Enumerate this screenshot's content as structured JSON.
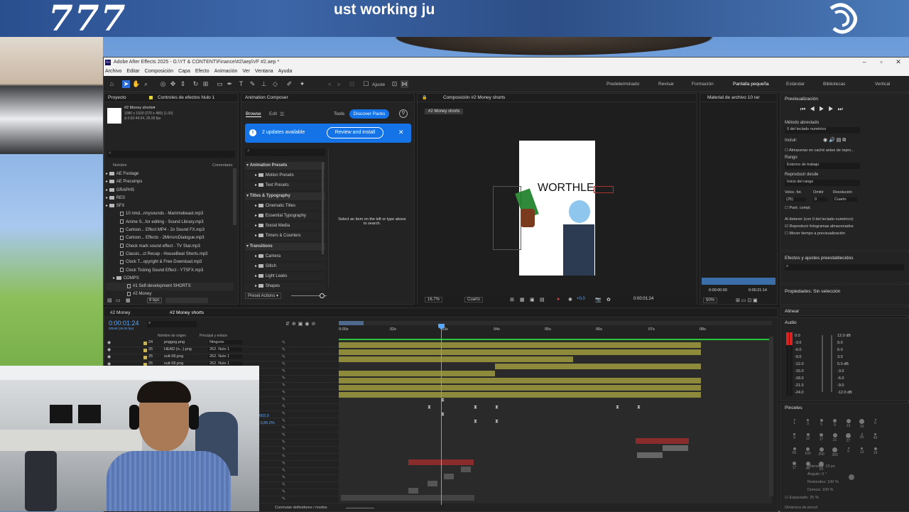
{
  "overlay": {
    "banner_number": "777",
    "banner_subtitle": "ust working ju"
  },
  "app": {
    "title": "Adobe After Effects 2025 - G:\\YT & CONTENT\\Finance\\#2\\aep\\VF #2.aep *",
    "logo": "Ae"
  },
  "menu": [
    "Archivo",
    "Editar",
    "Composición",
    "Capa",
    "Efecto",
    "Animación",
    "Ver",
    "Ventana",
    "Ayuda"
  ],
  "toolbar": {
    "ajuste": "Ajuste",
    "workspaces": [
      "Predeterminado",
      "Revisar",
      "Formación",
      "Pantalla pequeña",
      "Estándar",
      "Bibliotecas",
      "Vertical"
    ]
  },
  "project": {
    "tab_project": "Proyecto",
    "tab_effects": "Controles de efectos Nulo 1",
    "comp_name": "#2 Money shorts▾",
    "comp_info1": "1080 x 1920 (270 x 480) (1.00)",
    "comp_info2": "Δ 0:02:44:24, 25.00 fps",
    "col_name": "Nombre",
    "col_comment": "Comentario",
    "items": [
      {
        "label": "AE Footage",
        "type": "folder",
        "indent": 0
      },
      {
        "label": "AE Precomps",
        "type": "folder",
        "indent": 0
      },
      {
        "label": "GRAPHS",
        "type": "folder",
        "indent": 0
      },
      {
        "label": "RES",
        "type": "folder",
        "indent": 0
      },
      {
        "label": "SFX",
        "type": "folder",
        "indent": 0
      },
      {
        "label": "10 nmd...nnysounds - Mammobeast.mp3",
        "type": "file",
        "indent": 1
      },
      {
        "label": "Anime S...for editing - Sound Library.mp3",
        "type": "file",
        "indent": 1
      },
      {
        "label": "Cartoon... Effect MP4 - 2o Sound FX.mp3",
        "type": "file",
        "indent": 1
      },
      {
        "label": "Cartoon... Effects - 2MirrorsDialogue.mp3",
        "type": "file",
        "indent": 1
      },
      {
        "label": "Check mark sound effect - TV Star.mp3",
        "type": "file",
        "indent": 1
      },
      {
        "label": "Classic...ct Recap - HouseBeat Shorts.mp3",
        "type": "file",
        "indent": 1
      },
      {
        "label": "Clock T...opyright & Free Download.mp3",
        "type": "file",
        "indent": 1
      },
      {
        "label": "Clock Ticking Sound Effect - YTSFX.mp3",
        "type": "file",
        "indent": 1
      },
      {
        "label": "COMPS",
        "type": "folder",
        "indent": 1
      },
      {
        "label": "#1 Self-development SHORTS",
        "type": "comp",
        "indent": 2
      },
      {
        "label": "#2 Money",
        "type": "comp",
        "indent": 2
      }
    ],
    "bpc": "8 bpc"
  },
  "composer": {
    "title": "Animation Composer",
    "tab_browse": "Browse",
    "tab_edit": "Edit",
    "tools": "Tools",
    "discover": "Discover Packs",
    "updates": "2 updates available",
    "review": "Review and install",
    "tree": [
      {
        "label": "Animation Presets",
        "level": 0
      },
      {
        "label": "Motion Presets",
        "level": 1
      },
      {
        "label": "Text Presets",
        "level": 1
      },
      {
        "label": "Titles & Typography",
        "level": 0
      },
      {
        "label": "Cinematic Titles",
        "level": 1
      },
      {
        "label": "Essential Typography",
        "level": 1
      },
      {
        "label": "Social Media",
        "level": 1
      },
      {
        "label": "Timers & Counters",
        "level": 1
      },
      {
        "label": "Transitions",
        "level": 0
      },
      {
        "label": "Camera",
        "level": 1
      },
      {
        "label": "Glitch",
        "level": 1
      },
      {
        "label": "Light Leaks",
        "level": 1
      },
      {
        "label": "Shapes",
        "level": 1
      }
    ],
    "hint": "Select an item on the left or type above to search.",
    "preset_actions": "Preset Actions ▾"
  },
  "composition": {
    "tab": "Composición #2 Money shorts",
    "chip": "#2 Money shorts",
    "zoom": "16.7%",
    "quality": "Cuarto",
    "exposure": "+0.0",
    "timecode": "0:00:01:24",
    "canvas_text": "WORTHLE"
  },
  "footage": {
    "title": "Material de archivo 10 rar",
    "in": "0:00:00:00",
    "out": "0:00:21:14",
    "zoom": "50%"
  },
  "preview": {
    "title": "Previsualización",
    "shortcut_label": "Método abreviado",
    "shortcut": "0 del teclado numérico",
    "include": "Incluir:",
    "cache": "Almacenar en caché antes de repro...",
    "range_label": "Rango",
    "range": "Entorno de trabajo",
    "play_from_label": "Reproducir desde",
    "play_from": "Inicio del rango",
    "fps_label": "Veloc. fot.",
    "skip_label": "Omitir",
    "res_label": "Resolución",
    "fps": "(25)",
    "skip": "0",
    "res": "Cuarto",
    "fullscreen": "Pant. compl.",
    "stop_label": "Al detener (con 0 del teclado numérico):",
    "cached_frames": "Reproducir fotogramas almacenados",
    "move_time": "Mover tiempo a previsualización"
  },
  "effects": {
    "title": "Efectos y ajustes preestablecidos"
  },
  "properties": {
    "title": "Propiedades: Sin selección"
  },
  "align": {
    "title": "Alinear"
  },
  "audio": {
    "title": "Audio",
    "left": [
      "0.0",
      "-3.0",
      "-6.0",
      "-9.0",
      "-12.0",
      "-15.0",
      "-18.0",
      "-21.0",
      "-24.0"
    ],
    "right": [
      "12.0 dB",
      "9.0",
      "6.0",
      "3.0",
      "0.0 dB",
      "-3.0",
      "-6.0",
      "-9.0",
      "-12.0 dB"
    ]
  },
  "brushes": {
    "title": "Pinceles",
    "sizes": [
      "1",
      "3",
      "5",
      "9",
      "13",
      "19",
      "5",
      "9",
      "13",
      "17",
      "21",
      "27",
      "35",
      "45",
      "65",
      "100",
      "200",
      "300",
      "9",
      "13",
      "19",
      "17",
      "45",
      "65"
    ],
    "diameter": "Diámetro: 13 px",
    "angle": "Ángulo: 0 °",
    "roundness": "Redondez: 100 %",
    "hardness": "Dureza: 100 %",
    "spacing": "Espaciado: 25 %",
    "dynamics": "Dinámica de pincel"
  },
  "timeline": {
    "tab1": "#2 Money",
    "tab2": "#2 Money shorts",
    "timecode": "0:00:01:24",
    "frames": "00049 (25.00 fps)",
    "col_source": "Nombre de origen",
    "col_parent": "Principal y enlace",
    "layers": [
      {
        "num": "24",
        "name": "pnggeg.png",
        "parent": "Ninguno"
      },
      {
        "num": "25",
        "name": "HEAD (n...).png",
        "parent": "262. Nulo 1"
      },
      {
        "num": "25",
        "name": "suit-06.png",
        "parent": "262. Nulo 1"
      },
      {
        "num": "25",
        "name": "suit-06.png",
        "parent": "262. Nulo 1"
      }
    ],
    "ruler": [
      "0:00s",
      "02s",
      "03s",
      "04s",
      "05s",
      "06s",
      "07s",
      "08s"
    ],
    "prop_values": [
      "1603.0",
      "0.0,85.0%"
    ],
    "footer": "Conmutar definidores / modos"
  }
}
